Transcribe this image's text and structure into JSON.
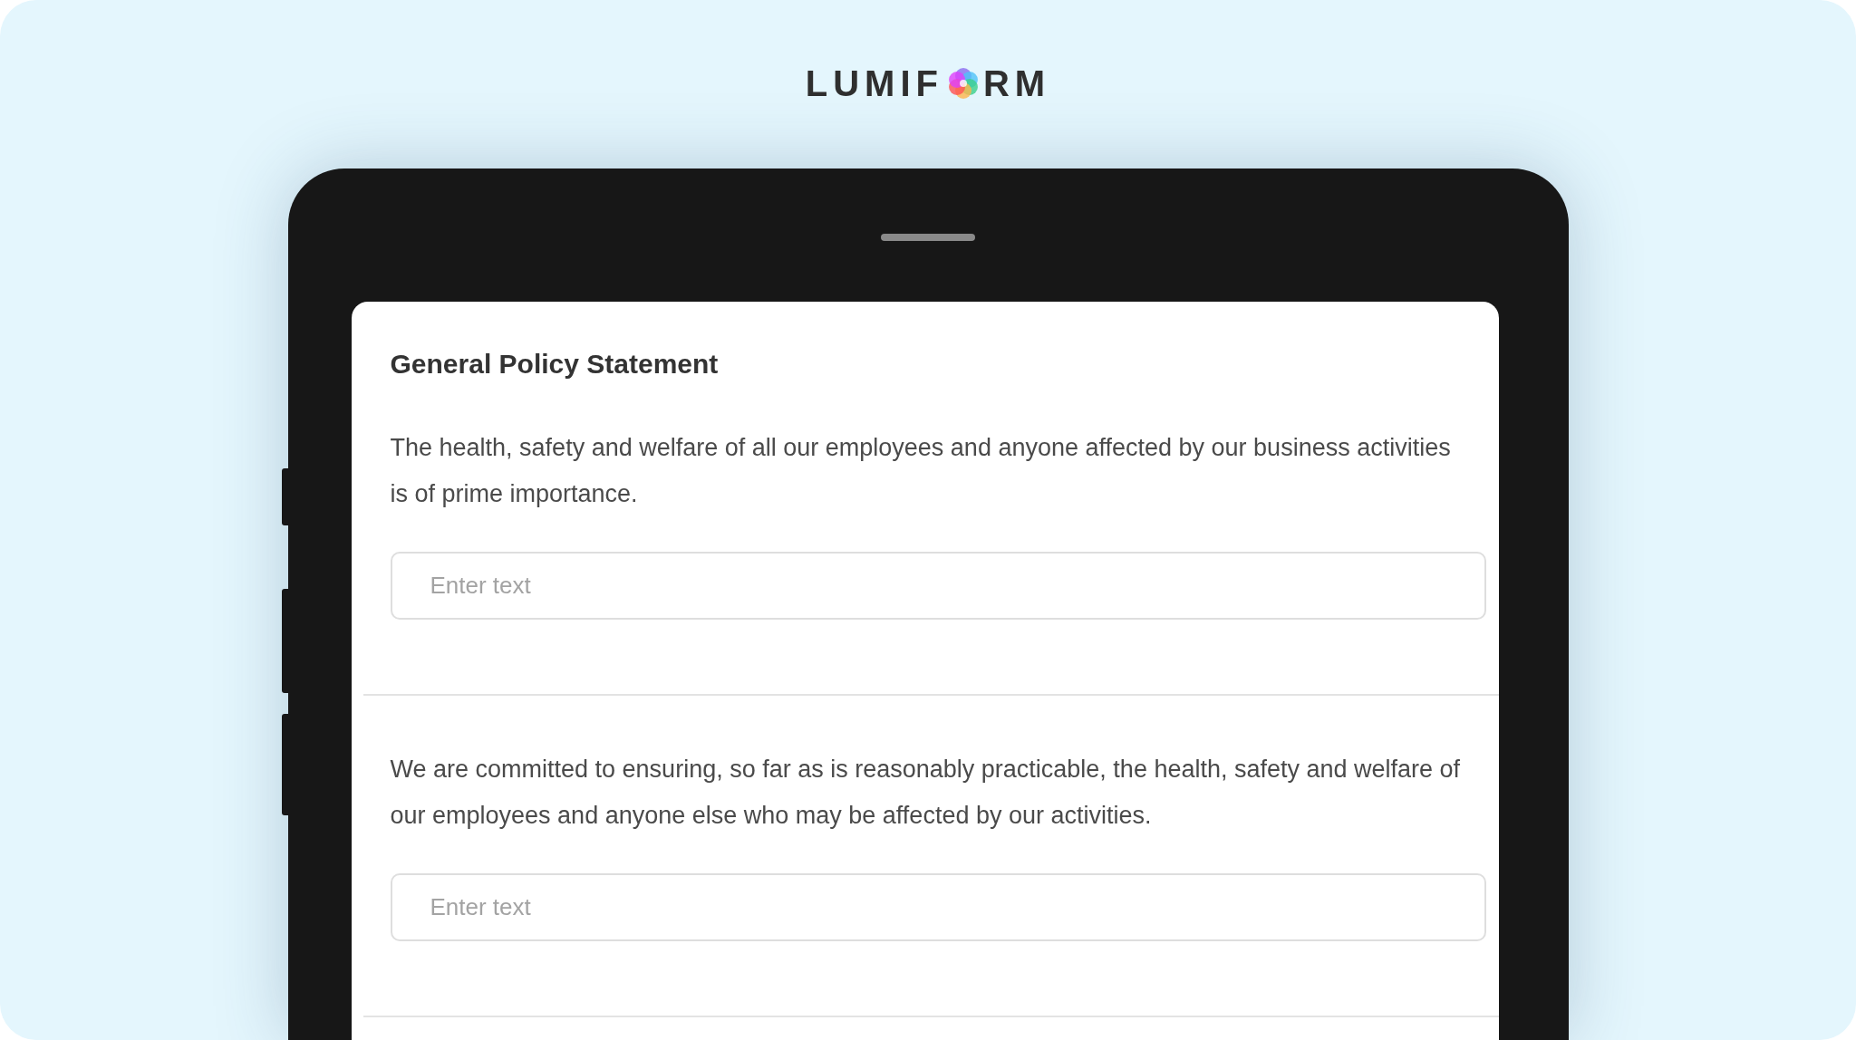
{
  "logo": {
    "before": "LUMIF",
    "after": "RM"
  },
  "form": {
    "title": "General Policy Statement",
    "questions": [
      {
        "text": "The health, safety and welfare of all our employees and anyone affected by our business activities is of prime importance.",
        "placeholder": "Enter text"
      },
      {
        "text": "We are committed to ensuring, so far as is reasonably practicable, the health, safety and welfare of our employees and anyone else who may be affected by our activities.",
        "placeholder": "Enter text"
      }
    ]
  }
}
